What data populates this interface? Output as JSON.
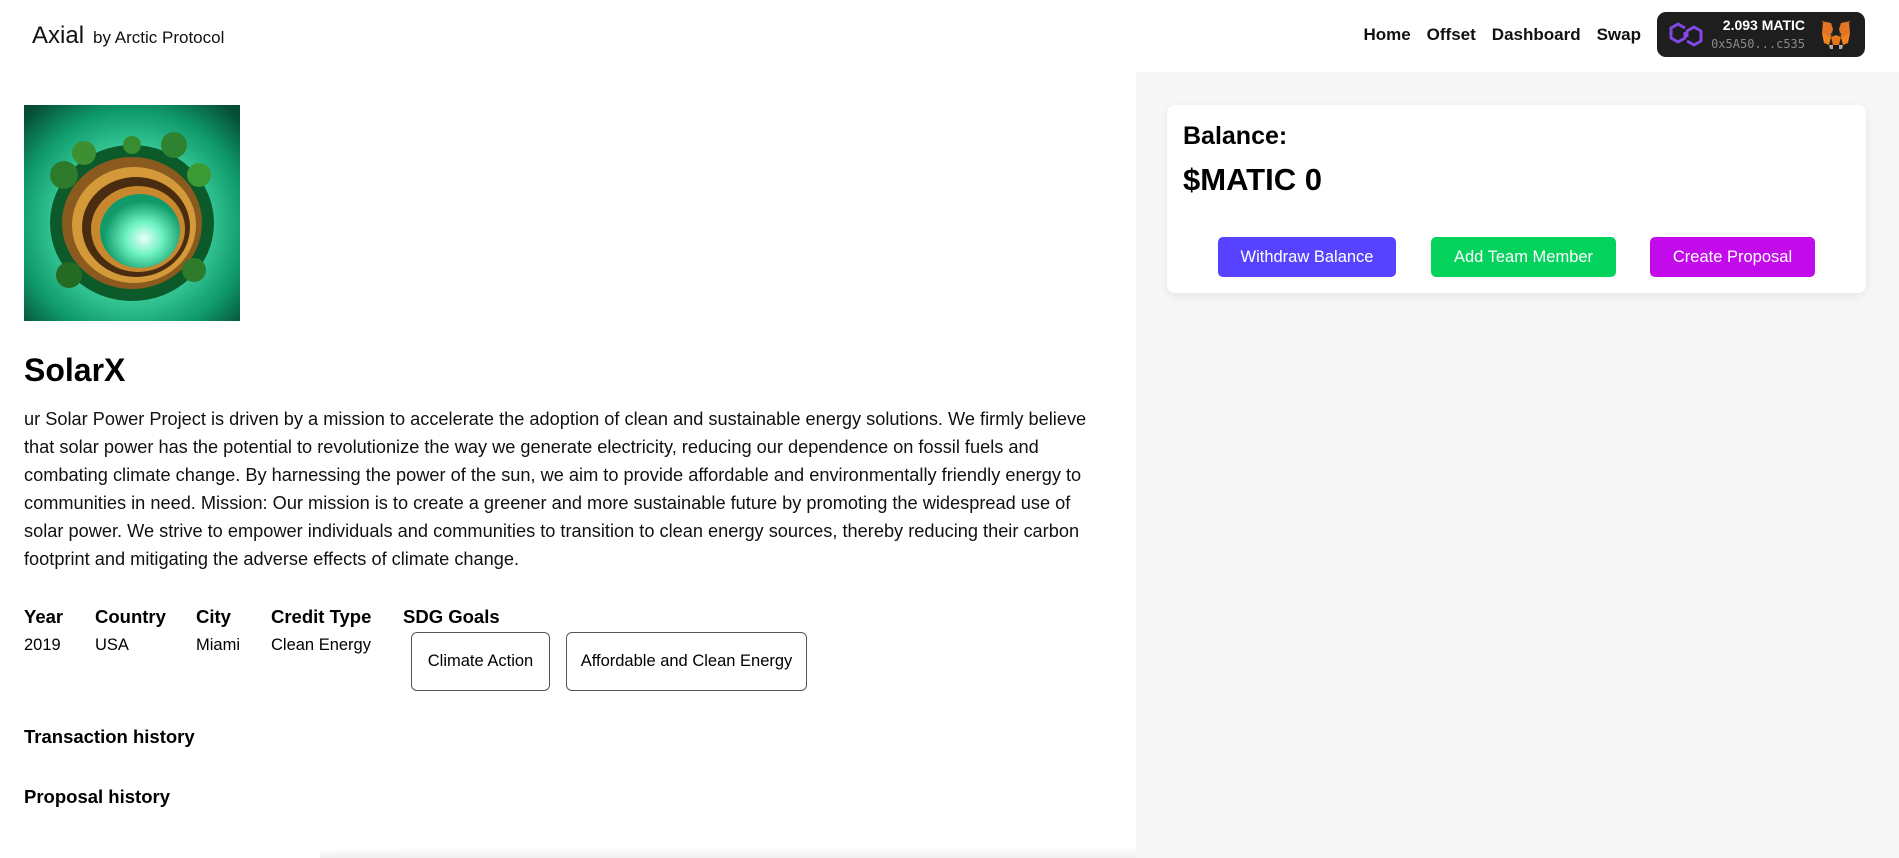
{
  "header": {
    "brand": "Axial",
    "by_line": "by Arctic Protocol",
    "nav": [
      {
        "label": "Home"
      },
      {
        "label": "Offset"
      },
      {
        "label": "Dashboard"
      },
      {
        "label": "Swap"
      }
    ],
    "wallet": {
      "balance": "2.093 MATIC",
      "address": "0x5A50...c535",
      "network_icon": "polygon-icon",
      "wallet_icon": "metamask-fox-icon"
    }
  },
  "project": {
    "image_icon": "solar-planet-image",
    "title": "SolarX",
    "description": "ur Solar Power Project is driven by a mission to accelerate the adoption of clean and sustainable energy solutions. We firmly believe that solar power has the potential to revolutionize the way we generate electricity, reducing our dependence on fossil fuels and combating climate change. By harnessing the power of the sun, we aim to provide affordable and environmentally friendly energy to communities in need. Mission: Our mission is to create a greener and more sustainable future by promoting the widespread use of solar power. We strive to empower individuals and communities to transition to clean energy sources, thereby reducing their carbon footprint and mitigating the adverse effects of climate change.",
    "meta": {
      "year_label": "Year",
      "year": "2019",
      "country_label": "Country",
      "country": "USA",
      "city_label": "City",
      "city": "Miami",
      "credit_type_label": "Credit Type",
      "credit_type": "Clean Energy",
      "sdg_label": "SDG Goals",
      "sdg_goals": [
        "Climate Action",
        "Affordable and Clean Energy"
      ]
    },
    "transaction_history_label": "Transaction history",
    "proposal_history_label": "Proposal history"
  },
  "balance_card": {
    "label": "Balance:",
    "value": "$MATIC 0",
    "buttons": {
      "withdraw": "Withdraw Balance",
      "add_member": "Add Team Member",
      "create_proposal": "Create Proposal"
    },
    "colors": {
      "withdraw": "#5743ff",
      "add_member": "#03d35d",
      "create_proposal": "#c20aeb"
    }
  }
}
